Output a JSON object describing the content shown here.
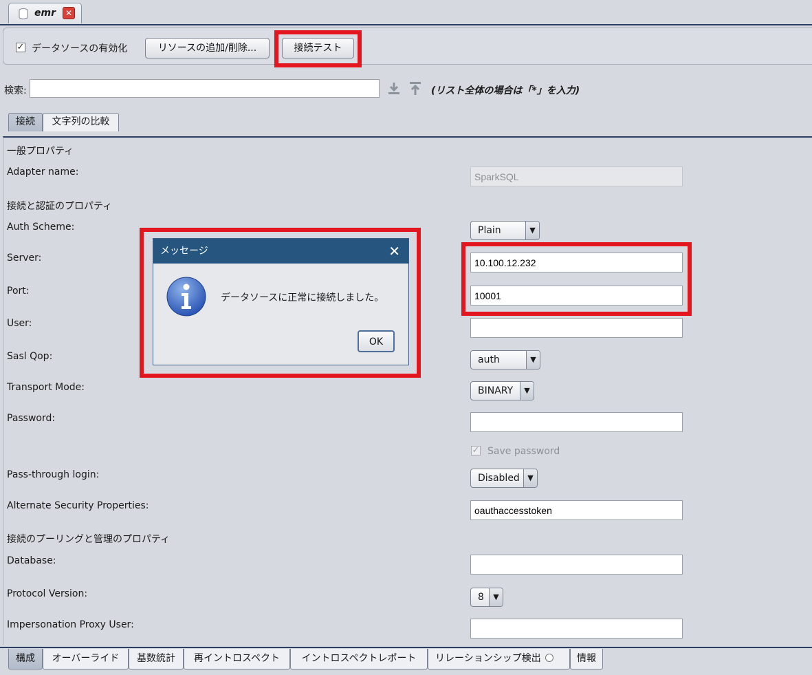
{
  "doc_tab": {
    "label": "emr",
    "icon": "database-icon",
    "close_icon": "close-icon"
  },
  "toolbar": {
    "enable_checkbox_label": "データソースの有効化",
    "enable_checked": true,
    "add_remove_label": "リソースの追加/削除...",
    "test_connection_label": "接続テスト"
  },
  "search": {
    "label": "検索:",
    "value": "",
    "hint": "(リスト全体の場合は「*」を入力)",
    "icons": [
      "download-icon",
      "upload-icon"
    ]
  },
  "property_tabs": [
    {
      "label": "接続",
      "selected": true
    },
    {
      "label": "文字列の比較",
      "selected": false
    }
  ],
  "sections": {
    "general": "一般プロパティ",
    "auth": "接続と認証のプロパティ",
    "pooling": "接続のプーリングと管理のプロパティ"
  },
  "properties": {
    "adapter_name": {
      "label": "Adapter name:",
      "value": "SparkSQL"
    },
    "auth_scheme": {
      "label": "Auth Scheme:",
      "value": "Plain"
    },
    "server": {
      "label": "Server:",
      "value": "10.100.12.232"
    },
    "port": {
      "label": "Port:",
      "value": "10001"
    },
    "user": {
      "label": "User:",
      "value": ""
    },
    "sasl_qop": {
      "label": "Sasl Qop:",
      "value": "auth"
    },
    "transport_mode": {
      "label": "Transport Mode:",
      "value": "BINARY"
    },
    "password": {
      "label": "Password:",
      "value": ""
    },
    "save_password": {
      "label": "Save password",
      "checked": true
    },
    "pass_through_login": {
      "label": "Pass-through login:",
      "value": "Disabled"
    },
    "alternate_security": {
      "label": "Alternate Security Properties:",
      "value": "oauthaccesstoken"
    },
    "database": {
      "label": "Database:",
      "value": ""
    },
    "protocol_version": {
      "label": "Protocol Version:",
      "value": "8"
    },
    "impersonation_proxy_user": {
      "label": "Impersonation Proxy User:",
      "value": ""
    }
  },
  "bottom_tabs": [
    {
      "label": "構成",
      "selected": true
    },
    {
      "label": "オーバーライド",
      "selected": false
    },
    {
      "label": "基数統計",
      "selected": false
    },
    {
      "label": "再イントロスペクト",
      "selected": false
    },
    {
      "label": "イントロスペクトレポート",
      "selected": false
    },
    {
      "label": "リレーションシップ検出",
      "selected": false
    },
    {
      "label": "情報",
      "selected": false
    }
  ],
  "dialog": {
    "title": "メッセージ",
    "message": "データソースに正常に接続しました。",
    "ok_label": "OK",
    "icon": "info-icon"
  },
  "highlight_color": "#e3151e"
}
